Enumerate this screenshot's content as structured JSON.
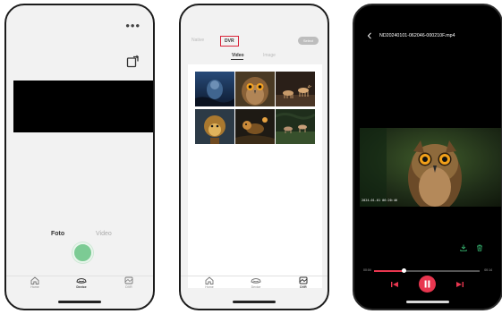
{
  "phone1": {
    "menu_glyph": "•••",
    "modes": {
      "foto": "Foto",
      "video": "Video"
    },
    "tabs": [
      {
        "label": "Home",
        "icon": "home-icon"
      },
      {
        "label": "Device",
        "icon": "device-icon"
      },
      {
        "label": "DVR",
        "icon": "dvr-icon"
      }
    ],
    "accent_color": "#7ccb94"
  },
  "phone2": {
    "sources": {
      "native": "Native",
      "dvr": "DVR"
    },
    "select_label": "Select",
    "subtabs": {
      "video": "Video",
      "image": "Image"
    },
    "tabs": [
      {
        "label": "Home",
        "icon": "home-icon"
      },
      {
        "label": "Device",
        "icon": "device-icon"
      },
      {
        "label": "DVR",
        "icon": "dvr-icon"
      }
    ],
    "highlight_color": "#d9253a"
  },
  "phone3": {
    "file_name": "ND20240101-062046-000210F.mp4",
    "timestamp": "2024-01-01 06:20:46",
    "time_start": "00:04",
    "time_end": "00:14",
    "progress": 0.28,
    "accent_color": "#e8364f"
  }
}
